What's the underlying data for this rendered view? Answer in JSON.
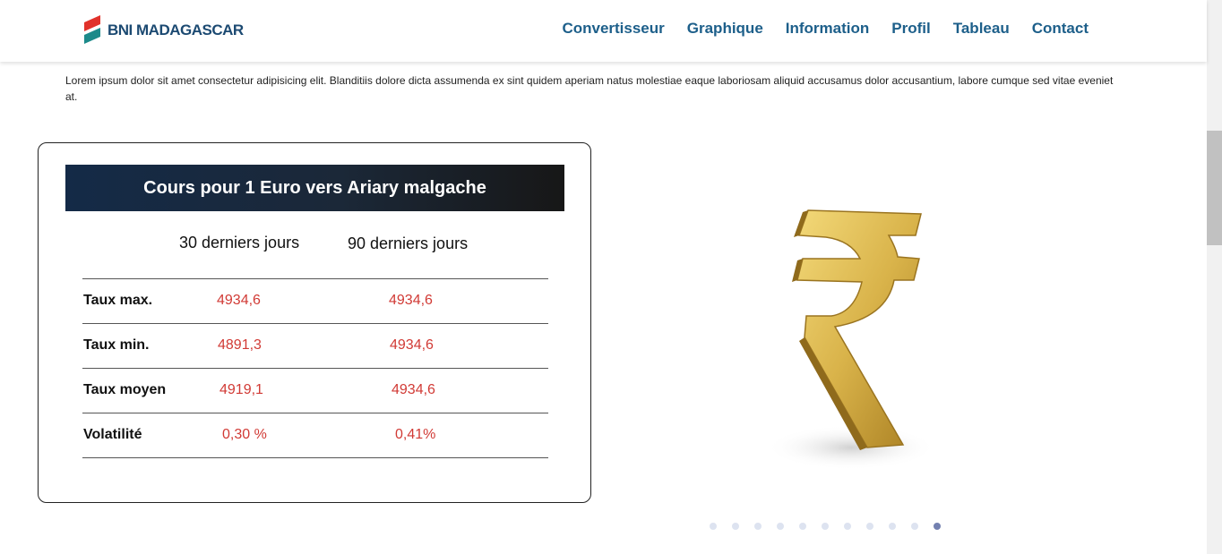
{
  "brand": {
    "name": "BNI MADAGASCAR",
    "logo_colors": [
      "#e1322b",
      "#1c8a8a"
    ]
  },
  "nav": {
    "links": [
      "Convertisseur",
      "Graphique",
      "Information",
      "Profil",
      "Tableau",
      "Contact"
    ],
    "color": "#1d5f8a"
  },
  "intro": "Lorem ipsum dolor sit amet consectetur adipisicing elit. Blanditiis dolore dicta assumenda ex sint quidem aperiam natus molestiae eaque laboriosam aliquid accusamus dolor accusantium, labore cumque sed vitae eveniet at.",
  "rates_card": {
    "title": "Cours pour 1 Euro vers Ariary malgache",
    "col_30": "30 derniers jours",
    "col_90": "90 derniers jours",
    "rows": [
      {
        "label": "Taux max.",
        "v30": "4934,6",
        "v90": "4934,6"
      },
      {
        "label": "Taux min.",
        "v30": "4891,3",
        "v90": "4934,6"
      },
      {
        "label": "Taux moyen",
        "v30": "4919,1",
        "v90": "4934,6"
      },
      {
        "label": "Volatilité",
        "v30": "0,30 %",
        "v90": "0,41%"
      }
    ],
    "value_color": "#d13a35"
  },
  "carousel": {
    "image_icon": "rupee-gold-icon",
    "dot_count": 11,
    "active_index": 10
  }
}
